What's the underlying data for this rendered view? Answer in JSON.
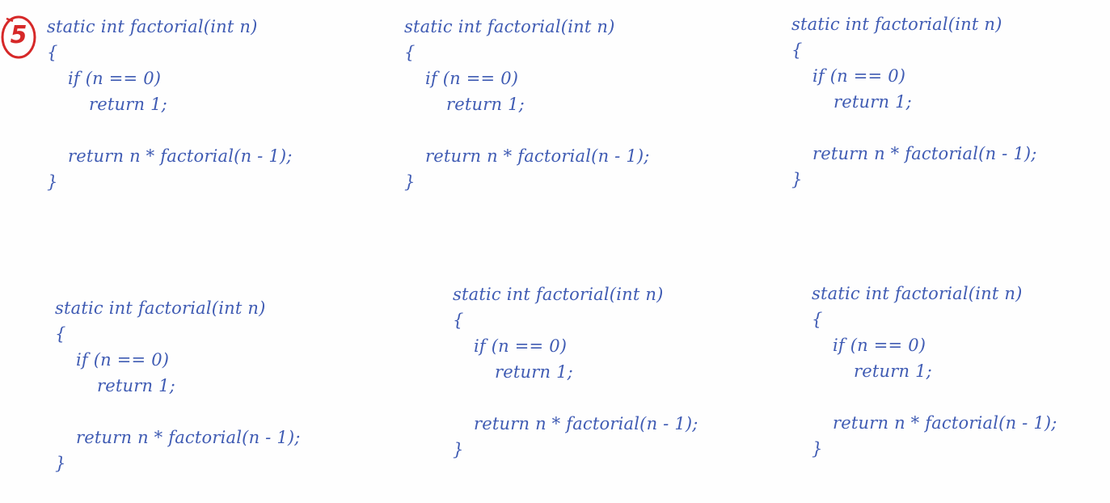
{
  "step_marker": "5",
  "blocks": [
    {
      "signature": "static int factorial(int n)",
      "open": "{",
      "if_line": "if (n == 0)",
      "return_base": "return 1;",
      "return_rec": "return n * factorial(n - 1);",
      "close": "}"
    },
    {
      "signature": "static int factorial(int n)",
      "open": "{",
      "if_line": "if (n == 0)",
      "return_base": "return 1;",
      "return_rec": "return n * factorial(n - 1);",
      "close": "}"
    },
    {
      "signature": "static int factorial(int n)",
      "open": "{",
      "if_line": "if (n == 0)",
      "return_base": "return 1;",
      "return_rec": "return n * factorial(n - 1);",
      "close": "}"
    },
    {
      "signature": "static int factorial(int n)",
      "open": "{",
      "if_line": "if (n == 0)",
      "return_base": "return 1;",
      "return_rec": "return n * factorial(n - 1);",
      "close": "}"
    },
    {
      "signature": "static int factorial(int n)",
      "open": "{",
      "if_line": "if (n == 0)",
      "return_base": "return 1;",
      "return_rec": "return n * factorial(n - 1);",
      "close": "}"
    },
    {
      "signature": "static int factorial(int n)",
      "open": "{",
      "if_line": "if (n == 0)",
      "return_base": "return 1;",
      "return_rec": "return n * factorial(n - 1);",
      "close": "}"
    }
  ],
  "colors": {
    "ink": "#3f5bb3",
    "marker": "#d62828",
    "background": "#fefefe"
  }
}
